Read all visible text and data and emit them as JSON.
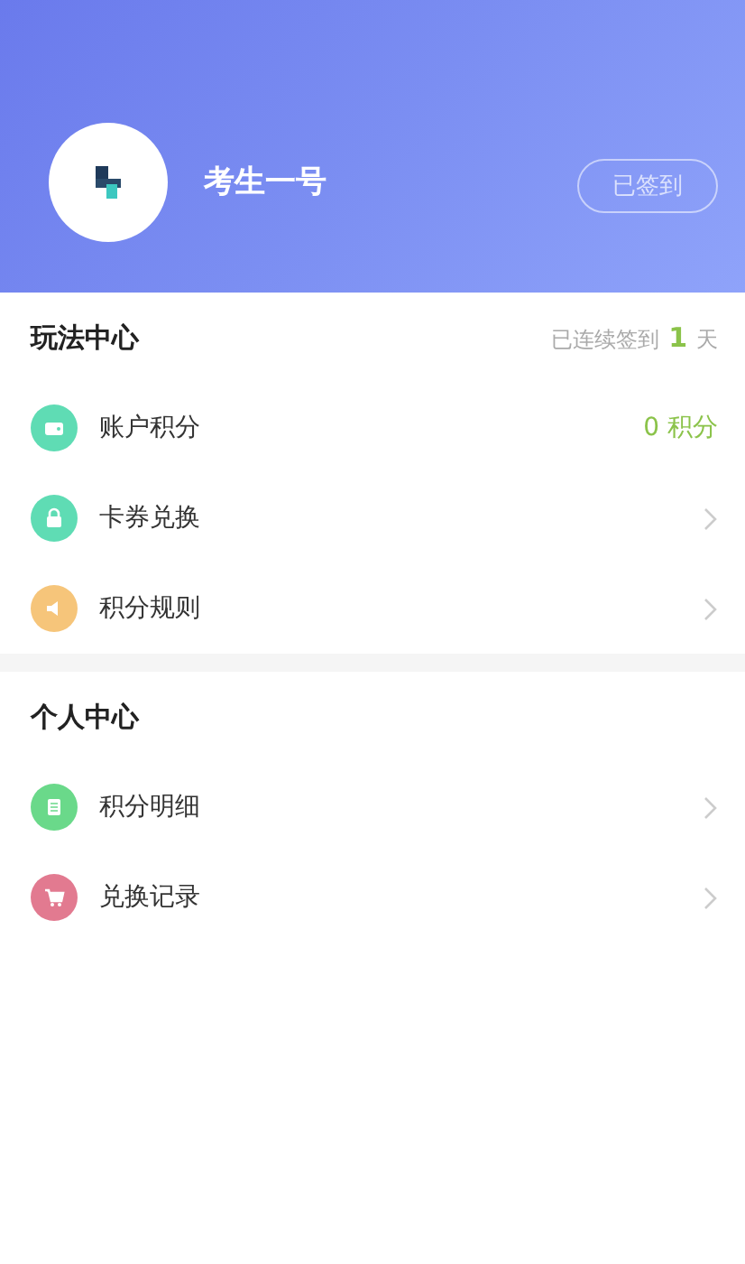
{
  "profile": {
    "name": "考生一号",
    "checkin_button": "已签到"
  },
  "sections": [
    {
      "title": "玩法中心",
      "streak": {
        "prefix": "已连续签到",
        "count": "1",
        "suffix": "天"
      },
      "items": [
        {
          "kind": "value",
          "color": "#5fdcb4",
          "label": "账户积分",
          "value": "0 积分"
        },
        {
          "kind": "link",
          "color": "#5fdcb4",
          "label": "卡券兑换"
        },
        {
          "kind": "link",
          "color": "#f6c57a",
          "label": "积分规则"
        }
      ]
    },
    {
      "title": "个人中心",
      "items": [
        {
          "kind": "link",
          "color": "#6ad98a",
          "label": "积分明细"
        },
        {
          "kind": "link",
          "color": "#e27a90",
          "label": "兑换记录"
        }
      ]
    }
  ]
}
